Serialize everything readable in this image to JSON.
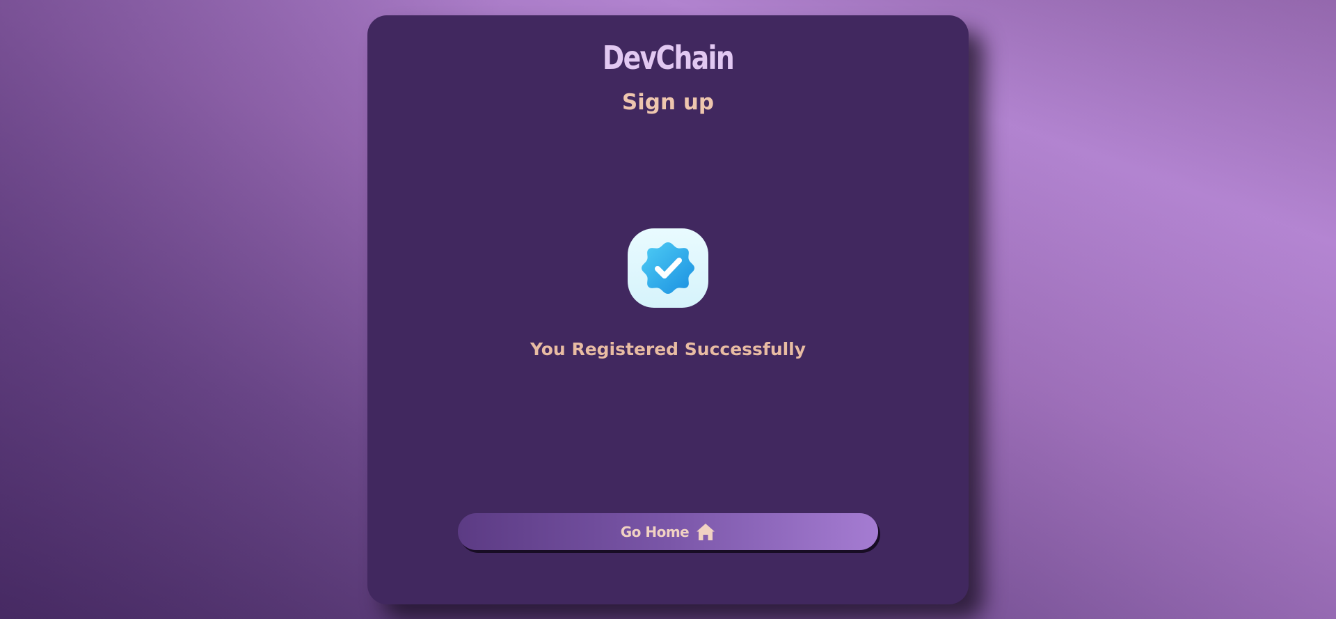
{
  "brand": {
    "name": "DevChain"
  },
  "page": {
    "subtitle": "Sign up",
    "success_message": "You Registered Successfully"
  },
  "actions": {
    "home_button_label": "Go Home",
    "home_button_icon": "home-icon"
  },
  "status": {
    "icon": "verified-badge-icon"
  },
  "colors": {
    "card_background": "#41285f",
    "brand_text": "#e2c8f2",
    "accent_text": "#eec6ae",
    "badge_blue": "#1ea6e8"
  }
}
